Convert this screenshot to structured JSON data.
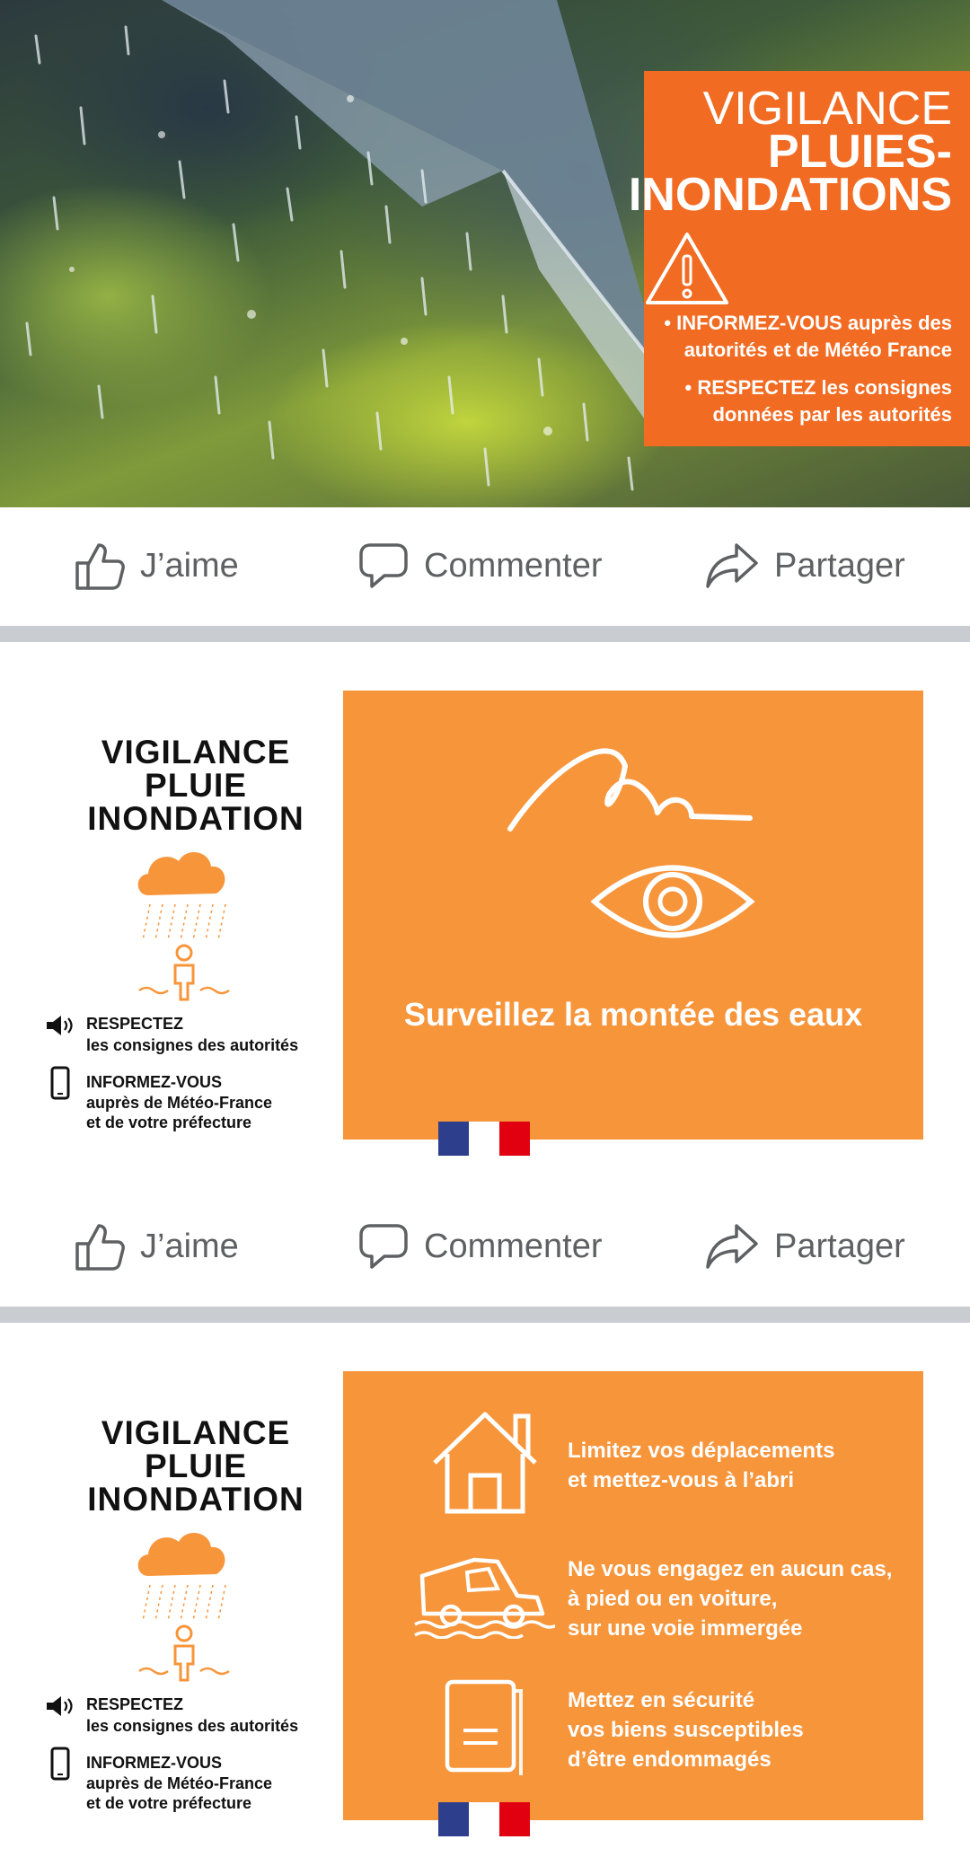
{
  "post1": {
    "title_line1": "VIGILANCE",
    "title_line2": "PLUIES-",
    "title_line3": "INONDATIONS",
    "bullet1_line1": "• INFORMEZ-VOUS auprès des",
    "bullet1_line2": "autorités et de Météo France",
    "bullet2_line1": "• RESPECTEZ les consignes",
    "bullet2_line2": "données par les autorités",
    "colors": {
      "box": "#f26b22"
    }
  },
  "actions": {
    "like": "J’aime",
    "comment": "Commenter",
    "share": "Partager"
  },
  "post2": {
    "title_line1": "VIGILANCE",
    "title_line2": "PLUIE",
    "title_line3": "INONDATION",
    "respect_head": "RESPECTEZ",
    "respect_text": "les consignes des autorités",
    "inform_head": "INFORMEZ-VOUS",
    "inform_line1": "auprès de Météo-France",
    "inform_line2": "et de votre préfecture",
    "panel_text": "Surveillez la montée des eaux",
    "colors": {
      "panel": "#f7953b"
    }
  },
  "post3": {
    "title_line1": "VIGILANCE",
    "title_line2": "PLUIE",
    "title_line3": "INONDATION",
    "respect_head": "RESPECTEZ",
    "respect_text": "les consignes des autorités",
    "inform_head": "INFORMEZ-VOUS",
    "inform_line1": "auprès de Météo-France",
    "inform_line2": "et de votre préfecture",
    "advice1_line1": "Limitez vos déplacements",
    "advice1_line2": "et mettez-vous à l’abri",
    "advice2_line1": "Ne vous engagez en aucun cas,",
    "advice2_line2": "à pied ou en voiture,",
    "advice2_line3": "sur une voie immergée",
    "advice3_line1": "Mettez en sécurité",
    "advice3_line2": "vos biens susceptibles",
    "advice3_line3": "d’être endommagés"
  },
  "icons": [
    "thumbs-up-icon",
    "comment-bubble-icon",
    "share-arrow-icon",
    "warning-triangle-icon",
    "cloud-rain-icon",
    "speaker-icon",
    "phone-icon",
    "wave-icon",
    "eye-icon",
    "house-icon",
    "car-flood-icon",
    "documents-icon",
    "republic-flag-logo"
  ]
}
